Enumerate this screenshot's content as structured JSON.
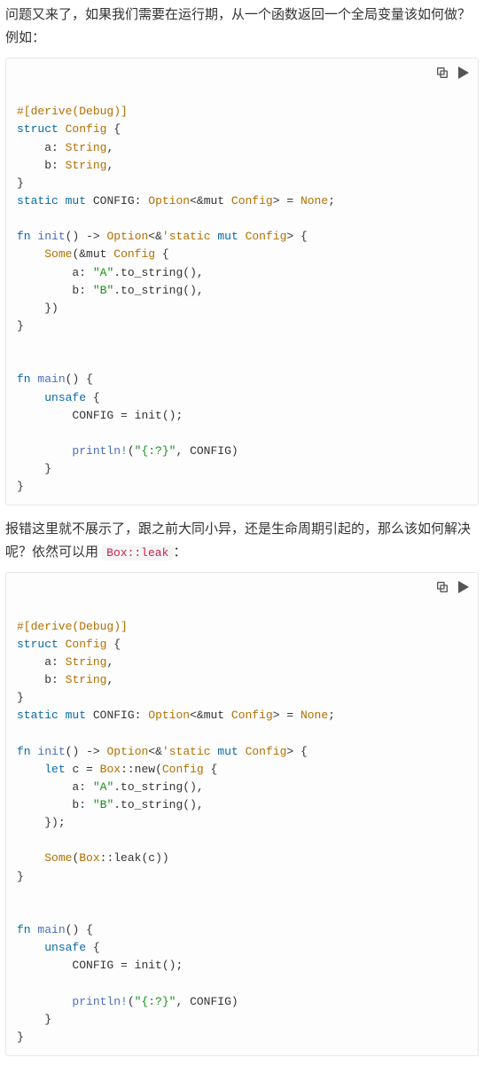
{
  "para1_a": "问题又来了，如果我们需要在运行期，从一个函数返回一个全局变量该如何做？例如：",
  "para2_a": "报错这里就不展示了，跟之前大同小异，还是生命周期引起的，那么该如何解决呢？依然可以用 ",
  "para2_code": "Box::leak",
  "para2_b": "：",
  "tok": {
    "derive": "#[derive(Debug)]",
    "struct": "struct",
    "Config": "Config",
    "a": "a",
    "b": "b",
    "String": "String",
    "static": "static",
    "mut": "mut",
    "CONFIG": "CONFIG",
    "Option": "Option",
    "None": "None",
    "fn": "fn",
    "init": "init",
    "tick_static": "'static",
    "Some": "Some",
    "strA": "\"A\"",
    "strB": "\"B\"",
    "to_string": ".to_string()",
    "main": "main",
    "unsafe": "unsafe",
    "eq_init": " = init();",
    "println": "println!",
    "fmt": "\"{:?}\"",
    "let": "let",
    "c": "c",
    "Box": "Box",
    "new": "::new(",
    "leak": "::leak(",
    "open_brace": " {",
    "close_brace": "}",
    "arrow": " -> ",
    "lt": "<",
    "gt": ">",
    "amp_mut": "&mut ",
    "amp": "&",
    "comma": ",",
    "colon": ": ",
    "eq_none": " = ",
    "semi": ";",
    "lp": "(",
    "rp": ")",
    "rp_semi": ");",
    "close_brace_rp": "})",
    "sep": ", "
  }
}
